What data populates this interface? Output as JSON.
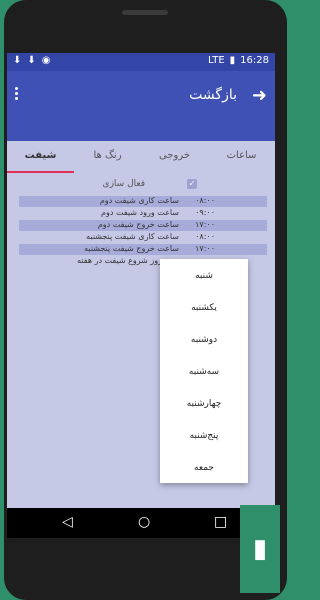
{
  "status": {
    "network": "LTE",
    "time": "16:28"
  },
  "appbar": {
    "title": "بازگشت"
  },
  "tabs": [
    {
      "label": "ساعات"
    },
    {
      "label": "خروجی"
    },
    {
      "label": "رنگ ها"
    },
    {
      "label": "شیفت"
    }
  ],
  "settings": {
    "enable_label": "فعال سازی",
    "rows": [
      {
        "label": "ساعت کاری شیفت دوم",
        "value": "۰۸:۰۰"
      },
      {
        "label": "ساعت ورود شیفت دوم",
        "value": "۰۹:۰۰"
      },
      {
        "label": "ساعت خروج شیفت دوم",
        "value": "۱۷:۰۰"
      },
      {
        "label": "ساعت کاری شیفت پنجشنبه",
        "value": "۰۸:۰۰"
      },
      {
        "label": "ساعت خروج شیفت پنجشنبه",
        "value": "۱۷:۰۰"
      },
      {
        "label": "روز شروع شیفت در هفته",
        "value": ""
      }
    ]
  },
  "dropdown": {
    "options": [
      "شنبه",
      "یکشنبه",
      "دوشنبه",
      "سه‌شنبه",
      "چهارشنبه",
      "پنج‌شنبه",
      "جمعه"
    ]
  },
  "colors": {
    "appbar": "#3f51b5",
    "accent": "#e0305a"
  }
}
